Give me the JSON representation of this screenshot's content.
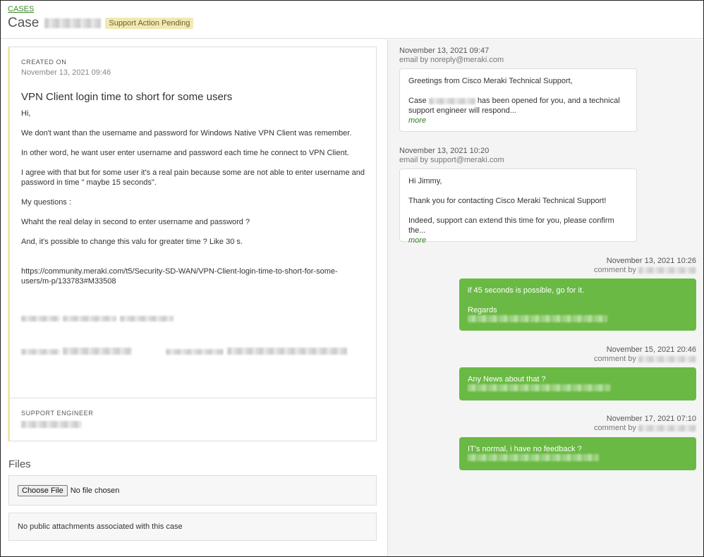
{
  "header": {
    "breadcrumb": "CASES",
    "case_prefix": "Case",
    "status_badge": "Support Action Pending"
  },
  "case": {
    "created_label": "CREATED ON",
    "created_value": "November 13, 2021 09:46",
    "subject": "VPN Client login time to short for some users",
    "description": [
      "Hi,",
      "We don't want than the username and password for Windows Native VPN Client was remember.",
      "In other word, he want user enter username and password each time he connect to VPN Client.",
      "I agree with that but for some user it's a real pain because some are not able to enter username and password in time \" maybe 15 seconds\".",
      "My questions :",
      "Whaht the real delay in second to enter username and password ?",
      "And, it's possible to change this valu for greater time ? Like 30 s.",
      "https://community.meraki.com/t5/Security-SD-WAN/VPN-Client-login-time-to-short-for-some-users/m-p/133783#M33508"
    ],
    "engineer_label": "SUPPORT ENGINEER"
  },
  "files": {
    "title": "Files",
    "choose_button": "Choose File",
    "no_file_text": "No file chosen",
    "no_attachments": "No public attachments associated with this case"
  },
  "timeline": [
    {
      "datetime": "November 13, 2021 09:47",
      "byline": "email by noreply@meraki.com",
      "lines": [
        "Greetings from Cisco Meraki Technical Support,",
        "has been opened for you, and a technical support engineer will respond..."
      ],
      "case_word": "Case",
      "more": "more"
    },
    {
      "datetime": "November 13, 2021 10:20",
      "byline": "email by support@meraki.com",
      "lines": [
        "Hi Jimmy,",
        "Thank you for contacting Cisco Meraki Technical Support!",
        "Indeed, support can extend this time for you, please confirm the..."
      ],
      "more": "more"
    },
    {
      "datetime": "November 13, 2021 10:26",
      "byline": "comment by",
      "lines": [
        "if 45 seconds is possible, go for it.",
        "Regards"
      ]
    },
    {
      "datetime": "November 15, 2021 20:46",
      "byline": "comment by",
      "lines": [
        "Any News about that ?"
      ]
    },
    {
      "datetime": "November 17, 2021 07:10",
      "byline": "comment by",
      "lines": [
        "IT's normal, i have no feedback ?"
      ]
    }
  ]
}
